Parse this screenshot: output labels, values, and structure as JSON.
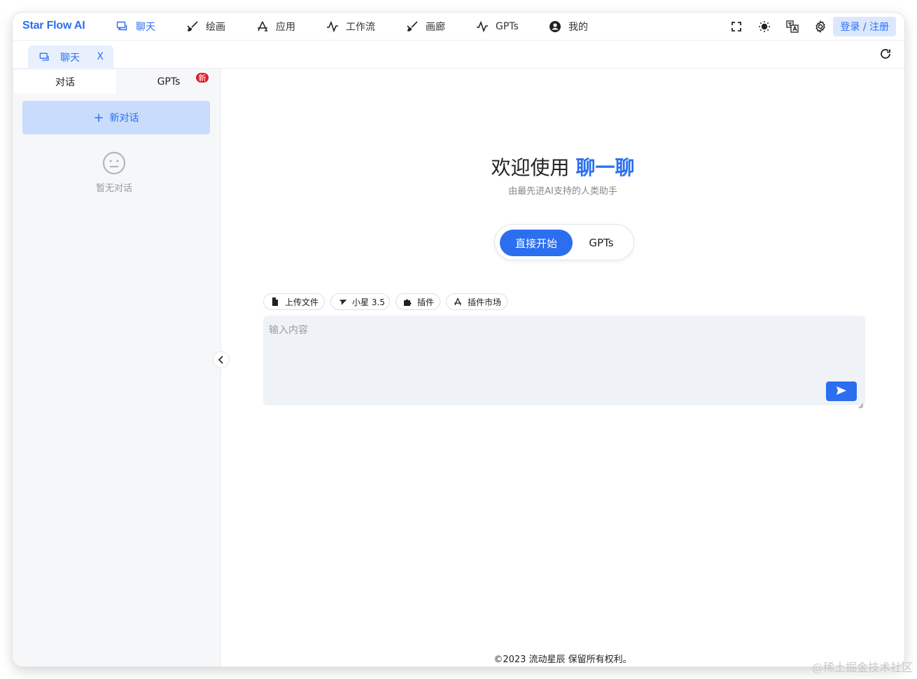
{
  "app": {
    "brand": "Star Flow AI"
  },
  "nav": {
    "items": [
      {
        "label": "聊天",
        "icon": "chat-icon"
      },
      {
        "label": "绘画",
        "icon": "brush-icon"
      },
      {
        "label": "应用",
        "icon": "app-store-icon"
      },
      {
        "label": "工作流",
        "icon": "pulse-icon"
      },
      {
        "label": "画廊",
        "icon": "brush-icon"
      },
      {
        "label": "GPTs",
        "icon": "pulse-icon"
      },
      {
        "label": "我的",
        "icon": "user-circle-icon"
      }
    ],
    "login_label": "登录 / 注册",
    "tools": [
      "fullscreen-icon",
      "sun-icon",
      "translate-icon",
      "gear-icon"
    ]
  },
  "tabstrip": {
    "active_tab": "聊天",
    "close_glyph": "X"
  },
  "sidebar": {
    "tabs": [
      "对话",
      "GPTs"
    ],
    "gpts_badge": "新",
    "new_chat_label": "新对话",
    "empty_text": "暂无对话"
  },
  "main": {
    "welcome_prefix": "欢迎使用 ",
    "welcome_highlight": "聊一聊",
    "subtitle": "由最先进AI支持的人类助手",
    "mode_start": "直接开始",
    "mode_gpts": "GPTs",
    "chips": [
      "上传文件",
      "小星 3.5",
      "插件",
      "插件市场"
    ],
    "input_placeholder": "输入内容"
  },
  "footer": {
    "copyright": "©2023 流动星辰 保留所有权利。"
  },
  "watermark": "@稀土掘金技术社区",
  "colors": {
    "accent": "#2b6ff0",
    "badge": "#e0202f",
    "new_chat_bg": "#c9dcfc"
  }
}
